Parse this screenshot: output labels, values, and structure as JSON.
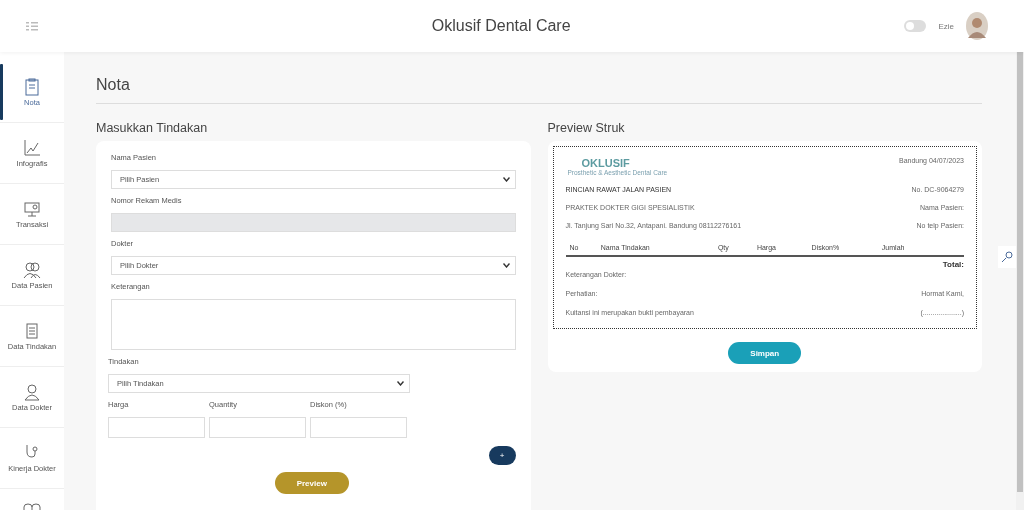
{
  "header": {
    "title": "Oklusif Dental Care",
    "user_name": "Ezie",
    "theme_toggle": {
      "on": false
    }
  },
  "sidebar": {
    "items": [
      {
        "label": "Nota",
        "selected": true
      },
      {
        "label": "Infografis",
        "selected": false
      },
      {
        "label": "Transaksi",
        "selected": false
      },
      {
        "label": "Data Pasien",
        "selected": false
      },
      {
        "label": "Data Tindakan",
        "selected": false
      },
      {
        "label": "Data Dokter",
        "selected": false
      },
      {
        "label": "Kinerja Dokter",
        "selected": false
      }
    ]
  },
  "page": {
    "title": "Nota"
  },
  "form": {
    "title": "Masukkan Tindakan",
    "fields": [
      {
        "kind": "select",
        "label": "Nama Pasien",
        "value": "Pilih Pasien"
      },
      {
        "kind": "readonly",
        "label": "Nomor Rekam Medis"
      },
      {
        "kind": "select",
        "label": "Dokter",
        "value": "Pilih Dokter"
      },
      {
        "kind": "textarea",
        "label": "Keterangan"
      }
    ],
    "tindakan": {
      "label": "Tindakan",
      "value": "Pilih Tindakan"
    },
    "inputs": [
      {
        "label": "Harga"
      },
      {
        "label": "Quantity"
      },
      {
        "label": "Diskon (%)"
      }
    ],
    "add_button": "+",
    "preview_button": "Preview"
  },
  "preview": {
    "title": "Preview Struk",
    "logo": {
      "name": "OKLUSIF",
      "tagline": "Prosthetic & Aesthetic Dental Care"
    },
    "date": "Bandung 04/07/2023",
    "left_lines": [
      "RINCIAN RAWAT JALAN PASIEN",
      "PRAKTEK DOKTER GIGI SPESIALISTIK",
      "Jl. Tanjung Sari No.32, Antapani. Bandung 08112276161"
    ],
    "right_lines": [
      "No. DC-9064279",
      "Nama Pasien:",
      "No telp Pasien:"
    ],
    "columns": [
      "No",
      "Nama Tindakan",
      "Qty",
      "Harga",
      "Diskon%",
      "Jumlah"
    ],
    "total_label": "Total:",
    "keterangan": "Keterangan Dokter:",
    "perhatian": "Perhatian:",
    "hormat": "Hormat Kami,",
    "note": "Kuitansi ini merupakan bukti pembayaran",
    "signature": "(....................)",
    "save_button": "Simpan"
  }
}
